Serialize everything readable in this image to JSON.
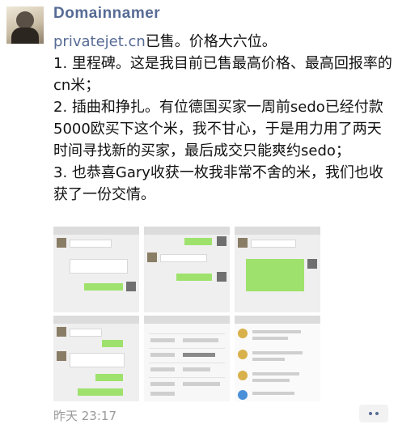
{
  "post": {
    "author": "Domainnamer",
    "domain": "privatejet.cn",
    "intro": "已售。价格大六位。",
    "point1": "1. 里程碑。这是我目前已售最高价格、最高回报率的cn米；",
    "point2": "2. 插曲和挣扎。有位德国买家一周前sedo已经付款5000欧买下这个米，我不甘心，于是用力用了两天时间寻找新的买家，最后成交只能爽约sedo；",
    "point3": "3. 也恭喜Gary收获一枚我非常不舍的米，我们也收获了一份交情。",
    "timestamp": "昨天 23:17"
  },
  "icons": {
    "more": "more-dots-icon",
    "avatar": "author-avatar"
  },
  "colors": {
    "link": "#576b95",
    "chat_green": "#9ee26d",
    "meta": "#9a9a9a"
  }
}
